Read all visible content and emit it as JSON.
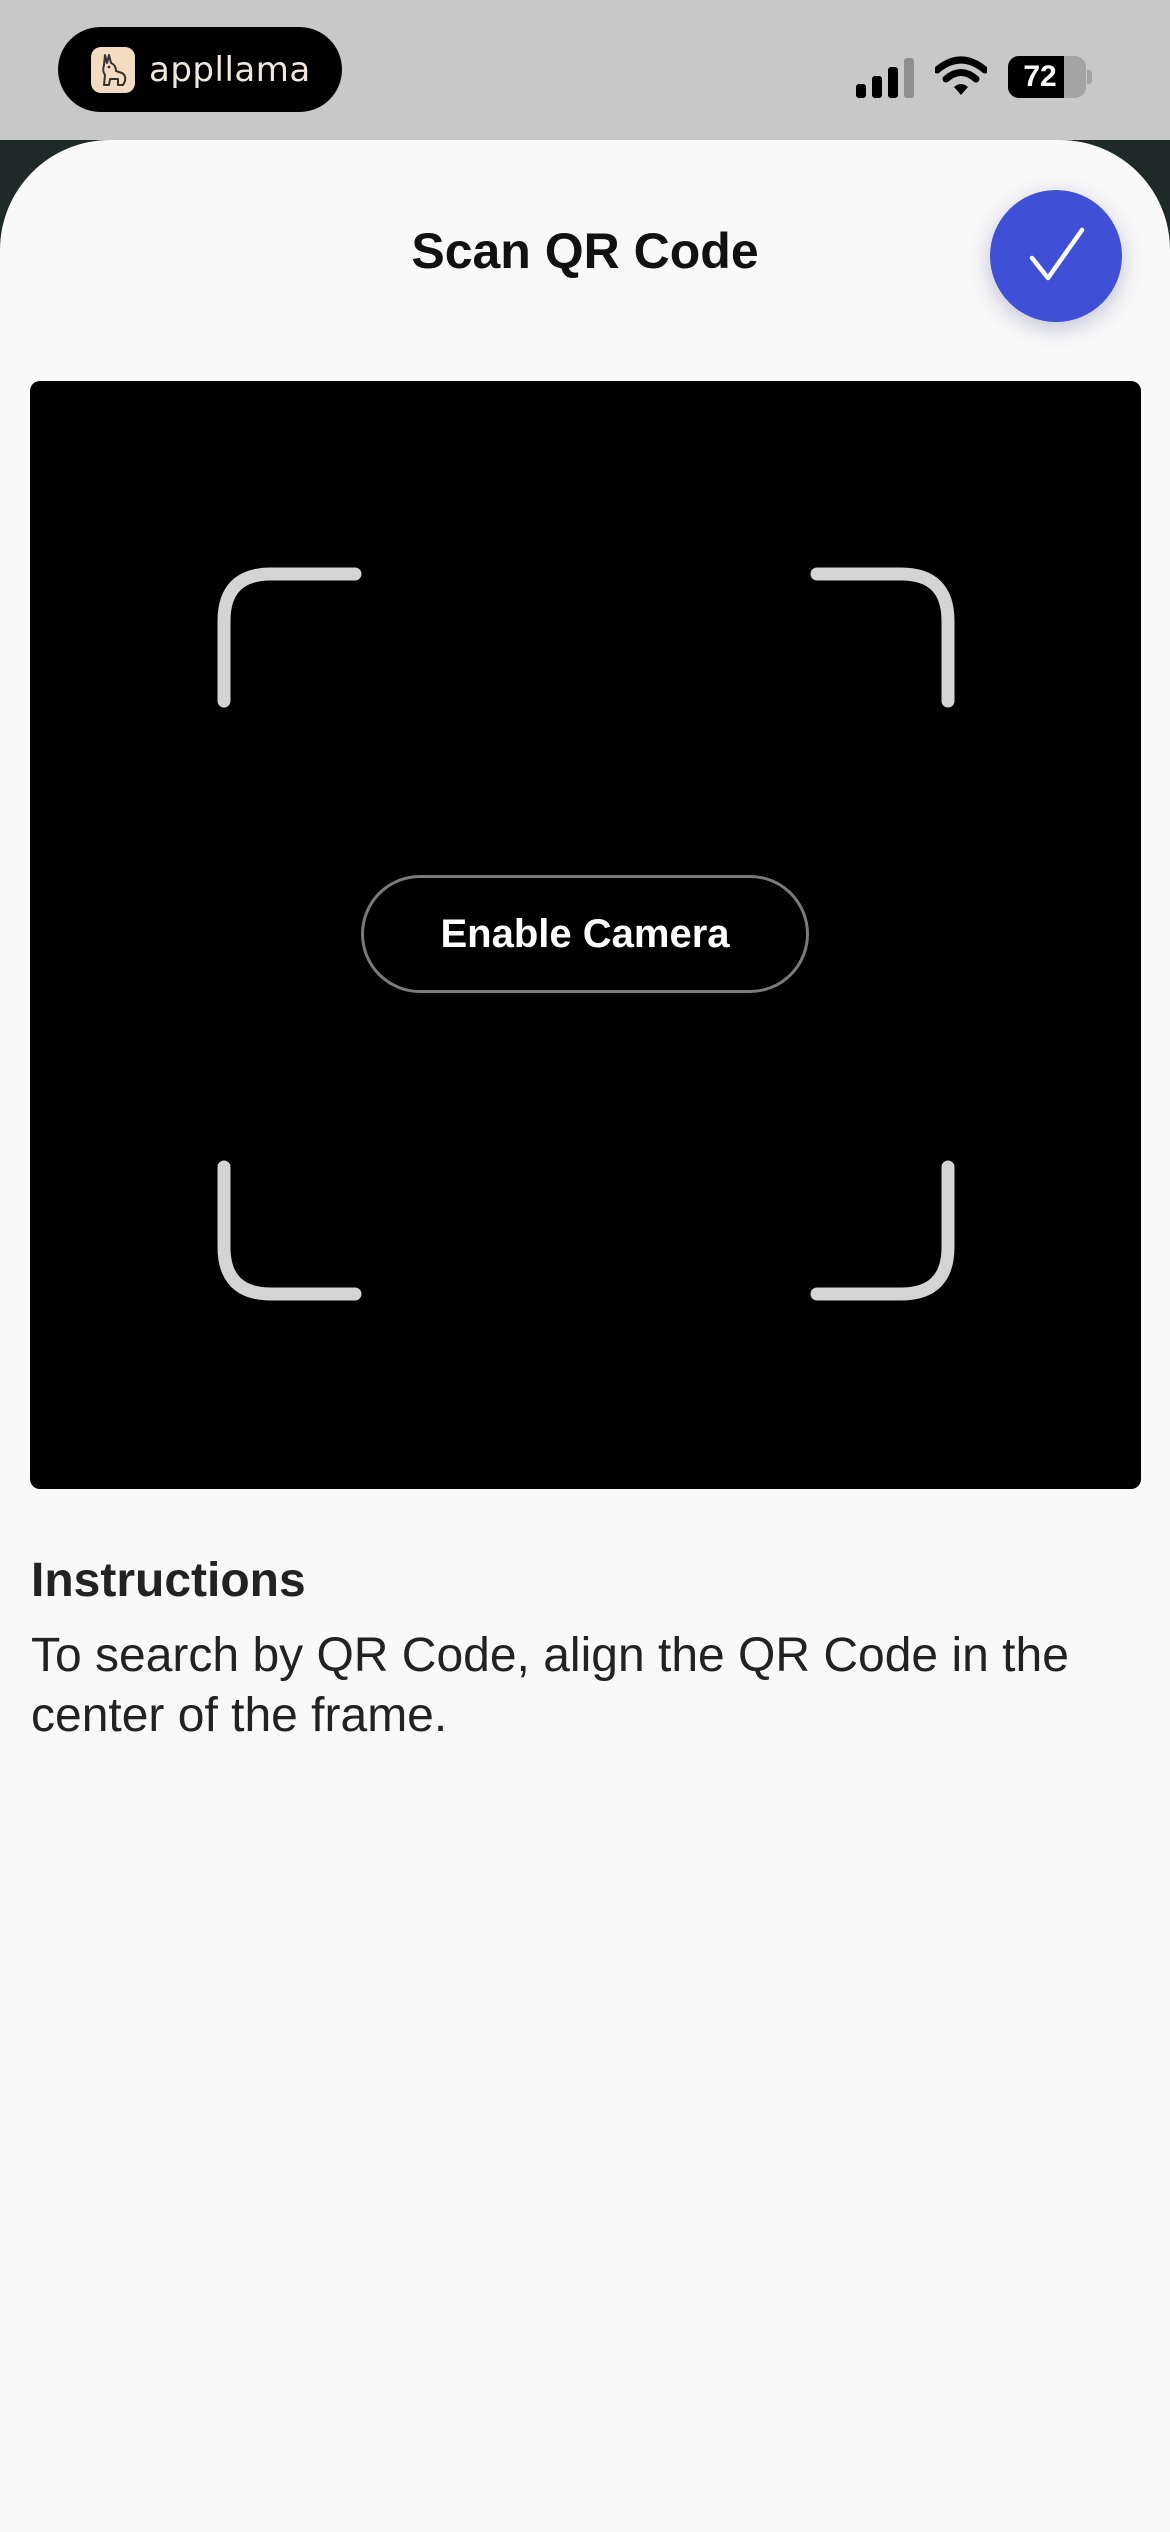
{
  "status_bar": {
    "app_name": "appllama",
    "app_icon": "llama-logo-icon",
    "battery_percent": 72,
    "battery_label": "72",
    "signal_icon": "cellular-signal-icon",
    "wifi_icon": "wifi-icon"
  },
  "sheet": {
    "title": "Scan QR Code",
    "done_icon": "checkmark-icon",
    "accent_color": "#3f4fd6"
  },
  "camera": {
    "enable_label": "Enable Camera"
  },
  "instructions": {
    "heading": "Instructions",
    "body": "To search by QR Code, align the QR Code in the center of the frame."
  }
}
